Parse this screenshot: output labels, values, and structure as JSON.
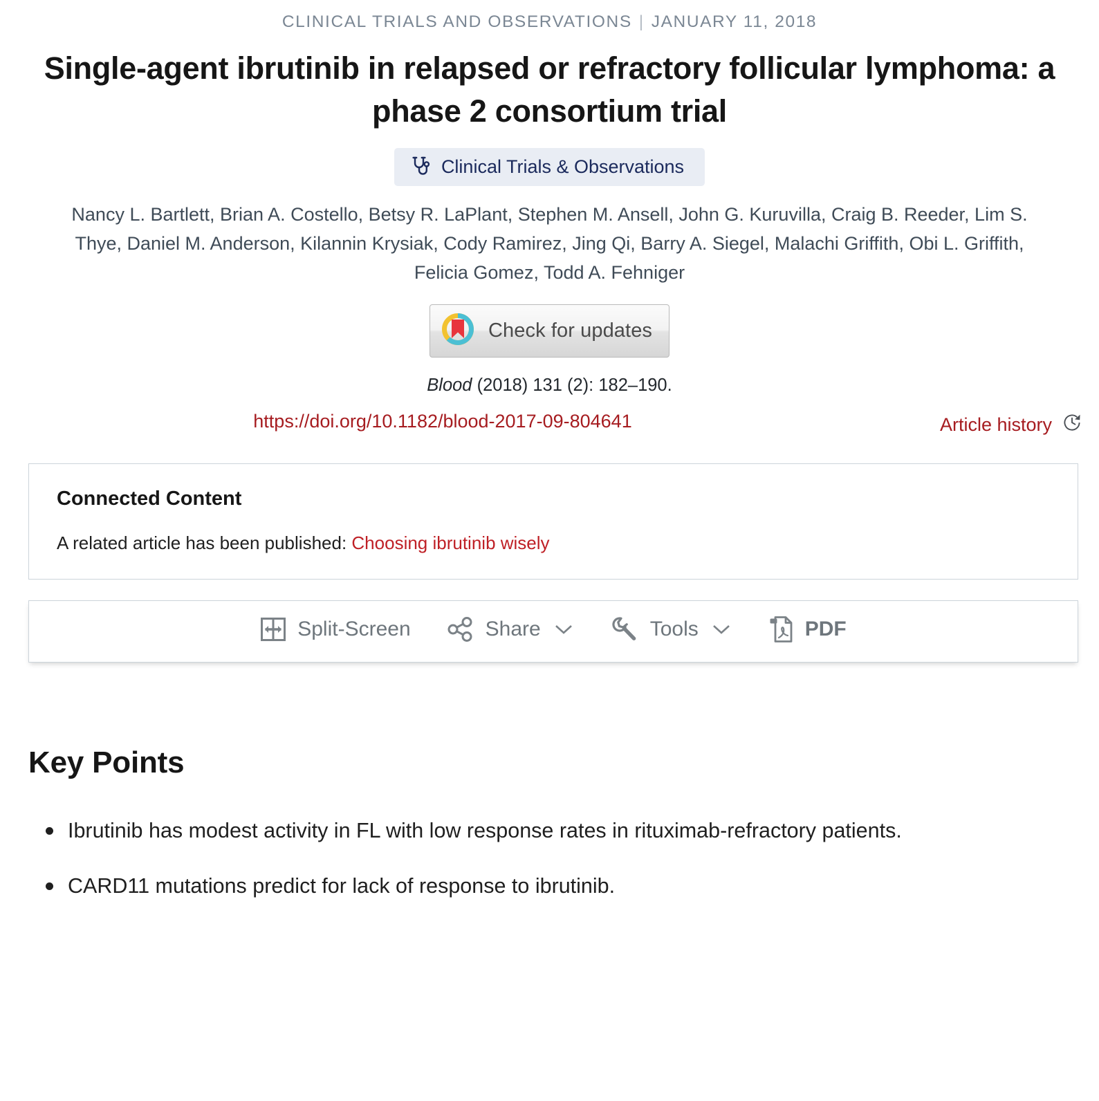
{
  "header": {
    "section": "CLINICAL TRIALS AND OBSERVATIONS",
    "separator": "|",
    "date": "JANUARY 11, 2018",
    "title": "Single-agent ibrutinib in relapsed or refractory follicular lymphoma: a phase 2 consortium trial",
    "subject_badge": {
      "label": "Clinical Trials & Observations",
      "icon": "stethoscope-icon",
      "background": "#e9edf4",
      "text_color": "#1b2a5c"
    },
    "authors": "Nancy L. Bartlett, Brian A. Costello, Betsy R. LaPlant, Stephen M. Ansell, John G. Kuruvilla, Craig B. Reeder, Lim S. Thye, Daniel M. Anderson, Kilannin Krysiak, Cody Ramirez, Jing Qi, Barry A. Siegel, Malachi Griffith, Obi L. Griffith, Felicia Gomez, Todd A. Fehniger"
  },
  "crossmark": {
    "label": "Check for updates",
    "icon": "crossmark-logo-icon"
  },
  "citation": {
    "journal": "Blood",
    "details": " (2018) 131 (2): 182–190.",
    "doi": "https://doi.org/10.1182/blood-2017-09-804641",
    "doi_color": "#a61c20"
  },
  "article_history": {
    "label": "Article history",
    "icon": "history-clock-icon",
    "color": "#a61c20"
  },
  "connected_content": {
    "title": "Connected Content",
    "text_prefix": "A related article has been published: ",
    "link_label": "Choosing ibrutinib wisely",
    "link_color": "#bf2026"
  },
  "toolbar": {
    "items": [
      {
        "label": "Split-Screen",
        "icon": "split-screen-icon",
        "caret": false
      },
      {
        "label": "Share",
        "icon": "share-nodes-icon",
        "caret": true
      },
      {
        "label": "Tools",
        "icon": "wrench-icon",
        "caret": true
      },
      {
        "label": "PDF",
        "icon": "pdf-file-icon",
        "caret": false
      }
    ]
  },
  "key_points": {
    "heading": "Key Points",
    "items": [
      "Ibrutinib has modest activity in FL with low response rates in rituximab-refractory patients.",
      "CARD11 mutations predict for lack of response to ibrutinib."
    ]
  }
}
